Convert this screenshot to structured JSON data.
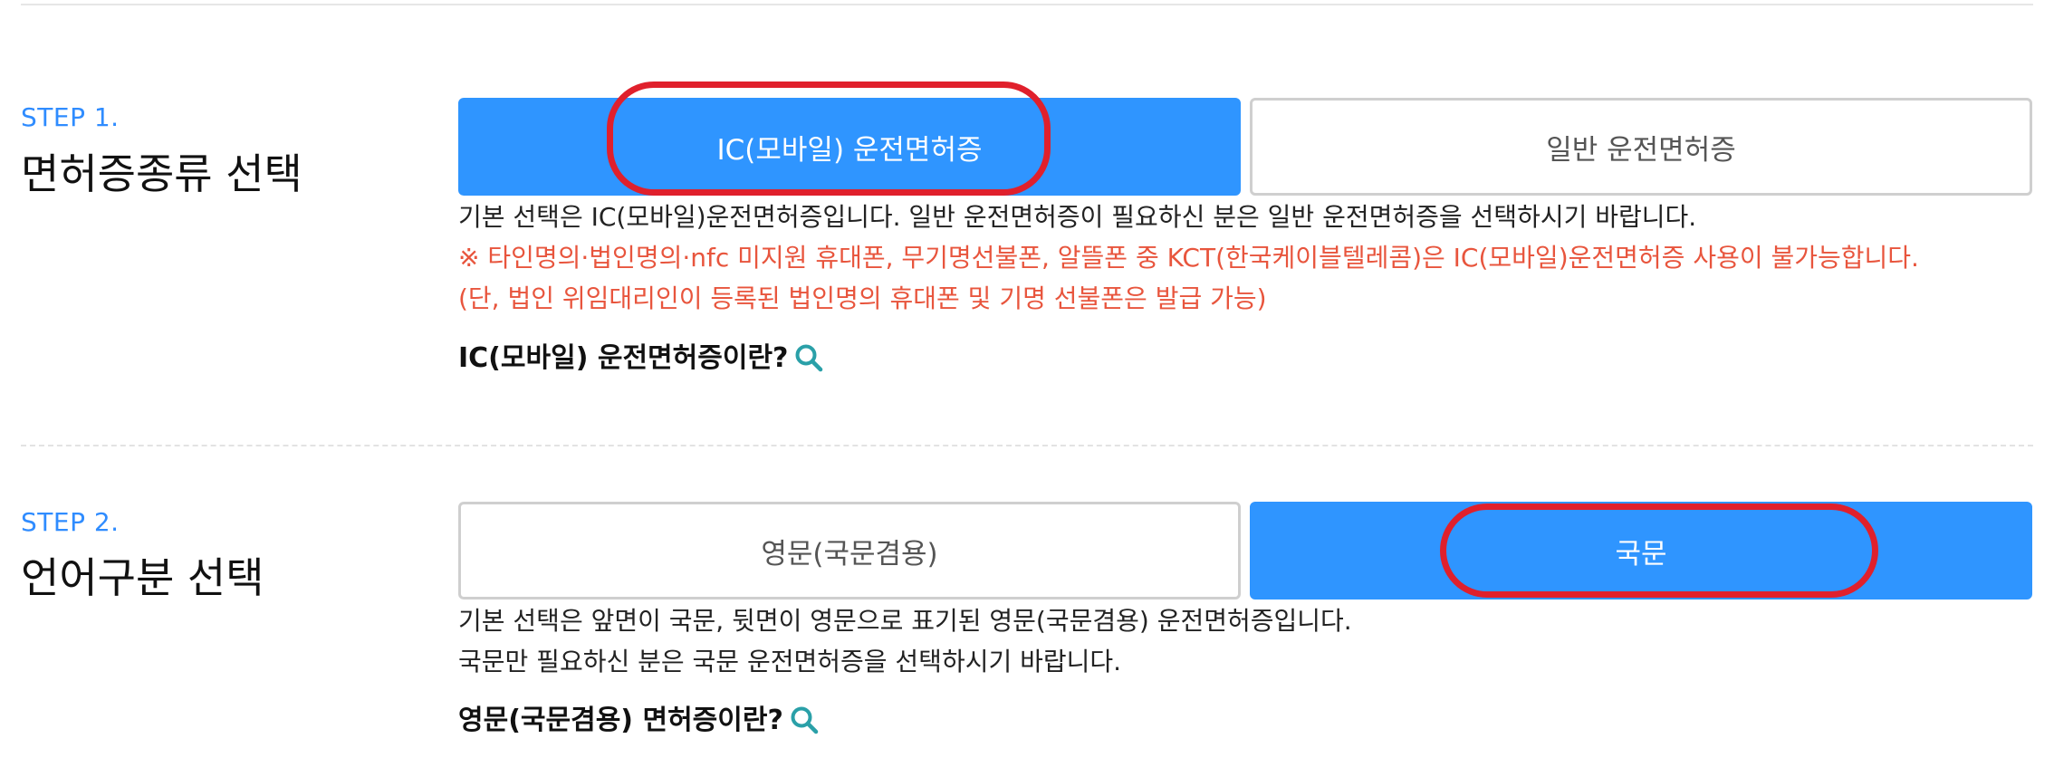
{
  "step1": {
    "step_label": "STEP 1.",
    "title": "면허증종류 선택",
    "option_ic": "IC(모바일) 운전면허증",
    "option_general": "일반 운전면허증",
    "selected": "option_ic",
    "desc_lines": [
      "기본 선택은 IC(모바일)운전면허증입니다. 일반 운전면허증이 필요하신 분은 일반 운전면허증을 선택하시기 바랍니다.",
      "※ 타인명의·법인명의·nfc 미지원 휴대폰, 무기명선불폰, 알뜰폰 중 KCT(한국케이블텔레콤)은 IC(모바일)운전면허증 사용이 불가능합니다.",
      "(단, 법인 위임대리인이 등록된 법인명의 휴대폰 및 기명 선불폰은 발급 가능)"
    ],
    "info_link": "IC(모바일) 운전면허증이란?"
  },
  "step2": {
    "step_label": "STEP 2.",
    "title": "언어구분 선택",
    "option_english": "영문(국문겸용)",
    "option_korean": "국문",
    "selected": "option_korean",
    "desc_lines": [
      "기본 선택은 앞면이 국문, 뒷면이 영문으로 표기된 영문(국문겸용) 운전면허증입니다.",
      "국문만 필요하신 분은 국문 운전면허증을 선택하시기 바랍니다."
    ],
    "info_link": "영문(국문겸용) 면허증이란?"
  },
  "colors": {
    "accent": "#2f95ff",
    "step_label": "#2f8cff",
    "warning_text": "#e8553d",
    "highlight_ring": "#e0202c",
    "search_icon": "#2aa0a8"
  },
  "icons": {
    "info_icon": "search-icon"
  }
}
